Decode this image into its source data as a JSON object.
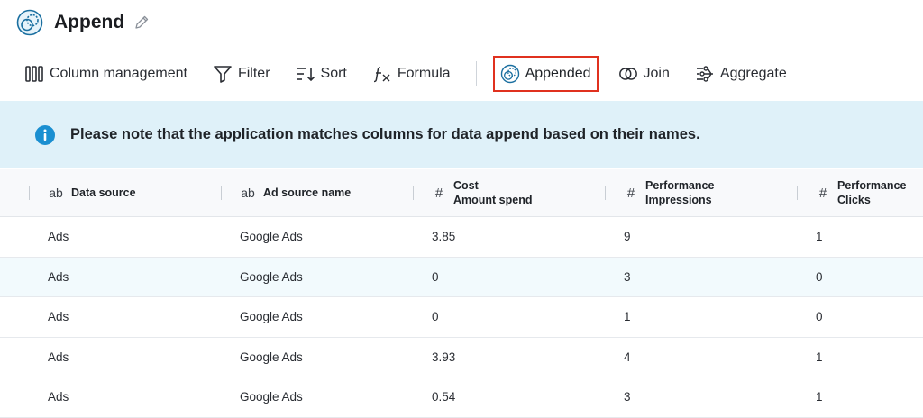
{
  "header": {
    "title": "Append",
    "app_icon": "append-circles-icon",
    "edit_icon": "pencil-icon"
  },
  "toolbar": {
    "items": [
      {
        "label": "Column management",
        "icon": "columns-icon"
      },
      {
        "label": "Filter",
        "icon": "filter-icon"
      },
      {
        "label": "Sort",
        "icon": "sort-icon"
      },
      {
        "label": "Formula",
        "icon": "formula-icon"
      },
      {
        "label": "Appended",
        "icon": "append-circles-icon",
        "active": true
      },
      {
        "label": "Join",
        "icon": "join-icon"
      },
      {
        "label": "Aggregate",
        "icon": "aggregate-icon"
      }
    ],
    "highlight_color": "#e0311f"
  },
  "info": {
    "icon": "info-icon",
    "text": "Please note that the application matches columns for data append based on their names."
  },
  "table": {
    "columns": [
      {
        "type_glyph": "ab",
        "line1": "Data source",
        "line2": ""
      },
      {
        "type_glyph": "ab",
        "line1": "Ad source name",
        "line2": ""
      },
      {
        "type_glyph": "#",
        "line1": "Cost",
        "line2": "Amount spend"
      },
      {
        "type_glyph": "#",
        "line1": "Performance",
        "line2": "Impressions"
      },
      {
        "type_glyph": "#",
        "line1": "Performance",
        "line2": "Clicks"
      }
    ],
    "rows": [
      [
        "Ads",
        "Google Ads",
        "3.85",
        "9",
        "1"
      ],
      [
        "Ads",
        "Google Ads",
        "0",
        "3",
        "0"
      ],
      [
        "Ads",
        "Google Ads",
        "0",
        "1",
        "0"
      ],
      [
        "Ads",
        "Google Ads",
        "3.93",
        "4",
        "1"
      ],
      [
        "Ads",
        "Google Ads",
        "0.54",
        "3",
        "1"
      ]
    ]
  },
  "colors": {
    "accent": "#1a7fb0",
    "info_bg": "#dff1f9",
    "info_icon": "#1a8fd1"
  }
}
